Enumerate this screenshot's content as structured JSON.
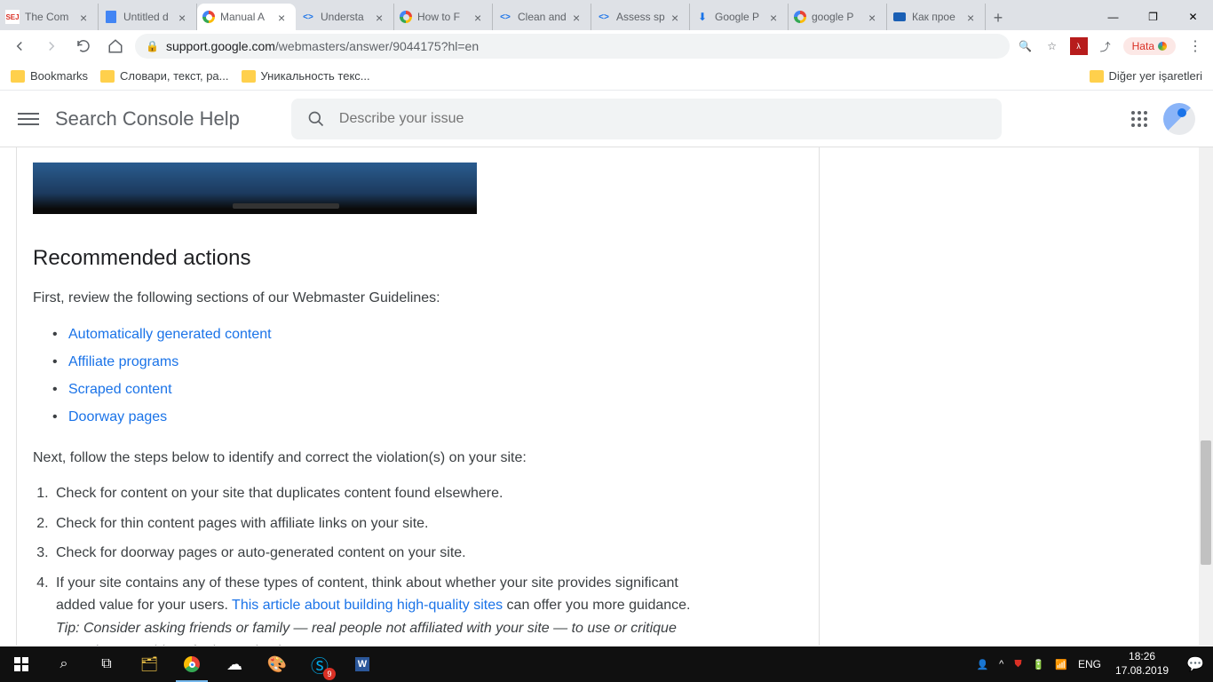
{
  "tabs": [
    {
      "title": "The Com",
      "favicon": "sej"
    },
    {
      "title": "Untitled d",
      "favicon": "docs"
    },
    {
      "title": "Manual A",
      "favicon": "g",
      "active": true
    },
    {
      "title": "Understa",
      "favicon": "code"
    },
    {
      "title": "How to F",
      "favicon": "g"
    },
    {
      "title": "Clean and",
      "favicon": "code"
    },
    {
      "title": "Assess sp",
      "favicon": "code"
    },
    {
      "title": "Google P",
      "favicon": "sm"
    },
    {
      "title": "google P",
      "favicon": "g"
    },
    {
      "title": "Как прое",
      "favicon": "yt"
    }
  ],
  "url": {
    "domain": "support.google.com",
    "path": "/webmasters/answer/9044175?hl=en"
  },
  "error_chip": "Hata",
  "bookmarks": {
    "items": [
      "Bookmarks",
      "Словари, текст, ра...",
      "Уникальность текс..."
    ],
    "other": "Diğer yer işaretleri"
  },
  "header": {
    "brand": "Search Console Help",
    "search_placeholder": "Describe your issue"
  },
  "content": {
    "heading": "Recommended actions",
    "intro": "First, review the following sections of our Webmaster Guidelines:",
    "links": [
      "Automatically generated content",
      "Affiliate programs",
      "Scraped content",
      "Doorway pages"
    ],
    "next": "Next, follow the steps below to identify and correct the violation(s) on your site:",
    "steps": [
      "Check for content on your site that duplicates content found elsewhere.",
      "Check for thin content pages with affiliate links on your site.",
      "Check for doorway pages or auto-generated content on your site."
    ],
    "step4_a": "If your site contains any of these types of content, think about whether your site provides significant added value for your users. ",
    "step4_link": "This article about building high-quality sites",
    "step4_b": " can offer you more guidance.",
    "step4_tip": "Tip: Consider asking friends or family — real people not affiliated with your site — to use or critique your site to get ideas for improving it."
  },
  "system": {
    "lang": "ENG",
    "time": "18:26",
    "date": "17.08.2019",
    "skype_badge": "9"
  }
}
